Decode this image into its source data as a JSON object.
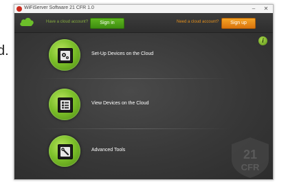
{
  "background_fragment": "d.",
  "window": {
    "title": "WiFiServer Software 21 CFR 1.0",
    "controls": {
      "minimize": "–",
      "close": "✕"
    }
  },
  "header": {
    "login_prompt": "Have a cloud account?",
    "signin_label": "Sign in",
    "account_prompt": "Need a cloud account?",
    "signup_label": "Sign up"
  },
  "menu": {
    "items": [
      {
        "label": "Set-Up Devices on the Cloud",
        "icon": "device-setup-icon"
      },
      {
        "label": "View Devices on the Cloud",
        "icon": "device-list-icon"
      },
      {
        "label": "Advanced Tools",
        "icon": "wrench-icon"
      }
    ]
  },
  "info_button": "i",
  "watermark": "21 CFR",
  "colors": {
    "accent_green": "#7cc02a",
    "accent_orange": "#e5901c",
    "panel": "#383838"
  }
}
